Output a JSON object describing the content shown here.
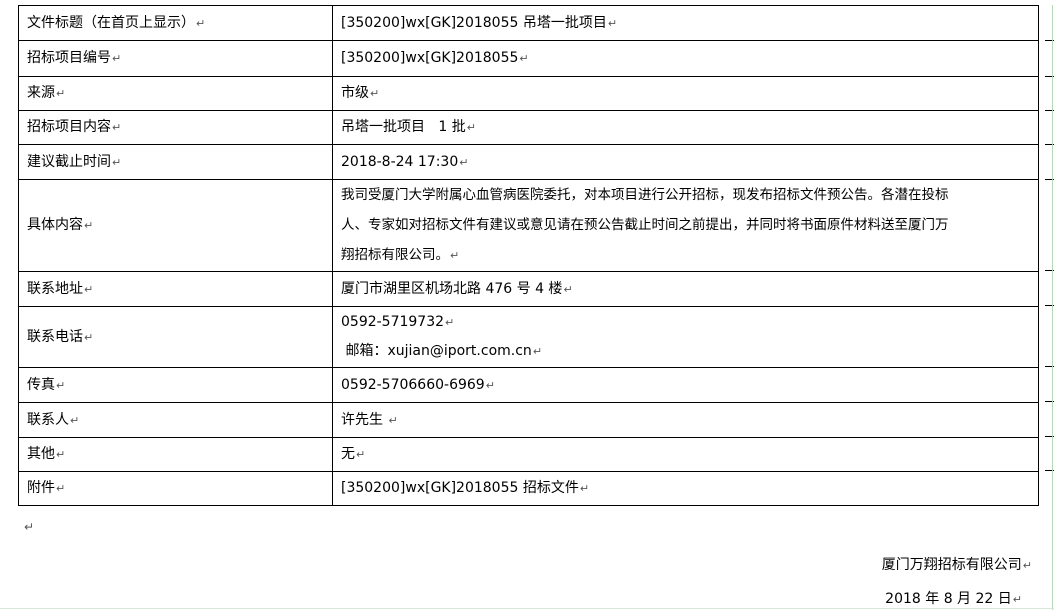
{
  "paragraph_mark": "↵",
  "rows": [
    {
      "label": "文件标题（在首页上显示）",
      "value": "[350200]wx[GK]2018055 吊塔一批项目"
    },
    {
      "label": "招标项目编号",
      "value": "[350200]wx[GK]2018055"
    },
    {
      "label": "来源",
      "value": "市级"
    },
    {
      "label": "招标项目内容",
      "value": "吊塔一批项目   1 批"
    },
    {
      "label": "建议截止时间",
      "value": "2018-8-24 17:30"
    },
    {
      "label": "具体内容",
      "lines": [
        "我司受厦门大学附属心血管病医院委托，对本项目进行公开招标，现发布招标文件预公告。各潜在投标",
        "人、专家如对招标文件有建议或意见请在预公告截止时间之前提出，并同时将书面原件材料送至厦门万",
        "翔招标有限公司。"
      ]
    },
    {
      "label": "联系地址",
      "value": "厦门市湖里区机场北路 476 号 4 楼"
    },
    {
      "label": "联系电话",
      "lines": [
        "0592-5719732",
        " 邮箱：xujian@iport.com.cn"
      ]
    },
    {
      "label": "传真",
      "value": "0592-5706660-6969"
    },
    {
      "label": "联系人",
      "value": "许先生 "
    },
    {
      "label": "其他",
      "value": "无"
    },
    {
      "label": "附件",
      "value": "[350200]wx[GK]2018055 招标文件"
    }
  ],
  "signature": {
    "company": "厦门万翔招标有限公司",
    "date": "2018 年 8 月 22 日"
  }
}
